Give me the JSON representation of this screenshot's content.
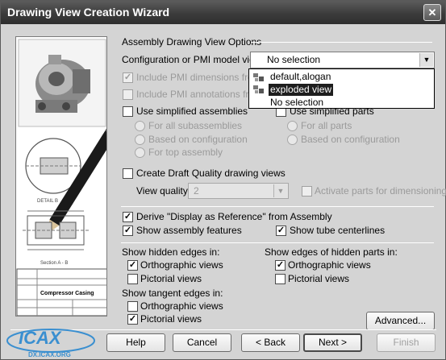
{
  "window": {
    "title": "Drawing View Creation Wizard",
    "close_glyph": "✕"
  },
  "illustration": {
    "title_block_text": "Compressor Casing",
    "detail_label": "DETAIL B",
    "section_label": "Section A - B"
  },
  "group": {
    "title": "Assembly Drawing View Options"
  },
  "config": {
    "label": "Configuration or PMI model view:",
    "value": "No selection",
    "options": [
      "default,alogan",
      "exploded view",
      "No selection"
    ],
    "selected_option": "exploded view"
  },
  "pmi": {
    "include_dimensions": "Include PMI dimensions from m",
    "include_annotations": "Include PMI annotations from"
  },
  "simplified": {
    "use_assemblies": "Use simplified assemblies",
    "use_parts": "Use simplified parts",
    "asm_all": "For all subassemblies",
    "asm_config": "Based on configuration",
    "asm_top": "For top assembly",
    "parts_all": "For all parts",
    "parts_config": "Based on configuration"
  },
  "draft": {
    "label": "Create Draft Quality drawing views",
    "view_quality_label": "View quality:",
    "view_quality_value": "2",
    "activate_parts": "Activate parts for dimensioning"
  },
  "derive": {
    "label": "Derive \"Display as Reference\" from Assembly",
    "show_assembly_features": "Show assembly features",
    "show_tube_centerlines": "Show tube centerlines"
  },
  "hidden_edges": {
    "title": "Show hidden edges in:",
    "orthographic": "Orthographic views",
    "pictorial": "Pictorial views"
  },
  "hidden_parts_edges": {
    "title": "Show edges of hidden parts in:",
    "orthographic": "Orthographic views",
    "pictorial": "Pictorial views"
  },
  "tangent_edges": {
    "title": "Show tangent edges in:",
    "orthographic": "Orthographic views",
    "pictorial": "Pictorial views"
  },
  "buttons": {
    "advanced": "Advanced...",
    "help": "Help",
    "cancel": "Cancel",
    "back": "< Back",
    "next": "Next >",
    "finish": "Finish"
  },
  "watermark": {
    "logo": "ICAX",
    "url": "DX.ICAX.ORG"
  },
  "checkmark_glyph": "✓",
  "icons": [
    "close-icon",
    "chevron-down-icon",
    "configuration-icon",
    "check-icon"
  ],
  "colors": {
    "titlebar": "#3c3c3c",
    "dialog_background": "#d4d4d4",
    "selection": "#1e1e1e",
    "watermark": "#3a8fd0"
  }
}
